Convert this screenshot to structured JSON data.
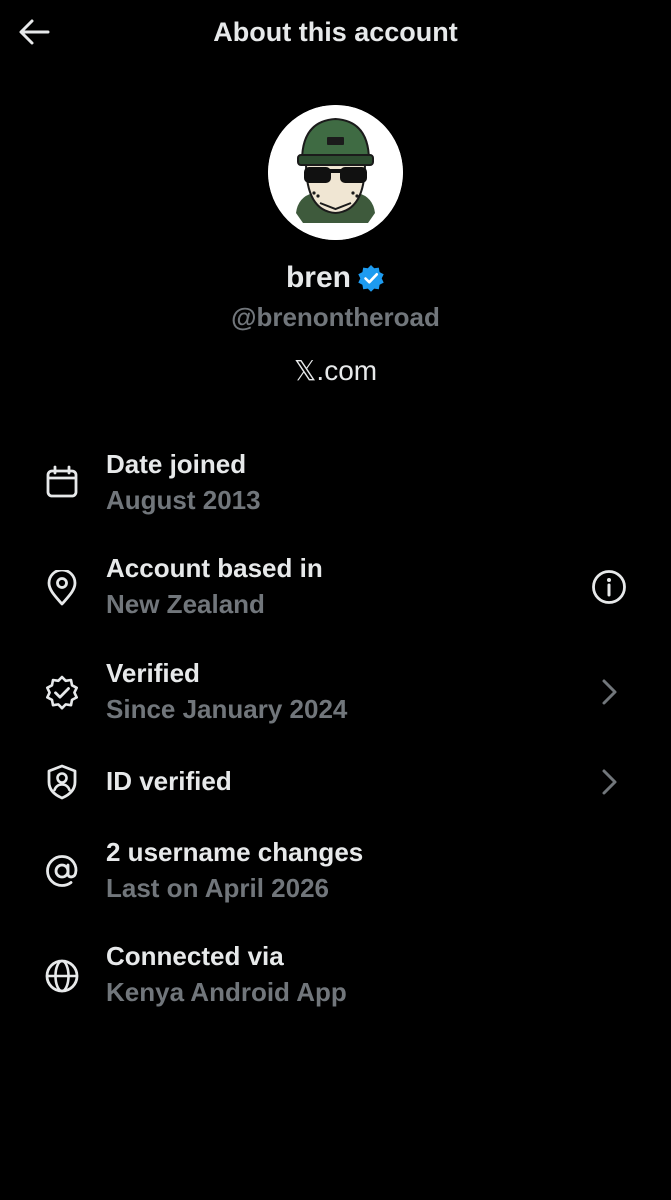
{
  "header": {
    "title": "About this account",
    "back_icon": "arrow-left-icon"
  },
  "profile": {
    "name": "bren",
    "handle": "@brenontheroad",
    "source": "𝕏.com",
    "verified_badge_color": "#1d9bf0",
    "avatar_icon": "avatar-cap-sunglasses"
  },
  "details": [
    {
      "icon": "calendar-icon",
      "title": "Date joined",
      "subtitle": "August 2013"
    },
    {
      "icon": "location-pin-icon",
      "title": "Account based in",
      "subtitle": "New Zealand",
      "action_icon": "info-icon"
    },
    {
      "icon": "verified-check-icon",
      "title": "Verified",
      "subtitle": "Since January 2024",
      "action_icon": "chevron-right-icon"
    },
    {
      "icon": "id-shield-icon",
      "title": "ID verified",
      "action_icon": "chevron-right-icon"
    },
    {
      "icon": "at-sign-icon",
      "title": "2 username changes",
      "subtitle": "Last on April 2026"
    },
    {
      "icon": "globe-icon",
      "title": "Connected via",
      "subtitle": "Kenya Android App"
    }
  ],
  "colors": {
    "background": "#000000",
    "primary_text": "#e7e9ea",
    "secondary_text": "#71767b",
    "accent": "#1d9bf0"
  }
}
